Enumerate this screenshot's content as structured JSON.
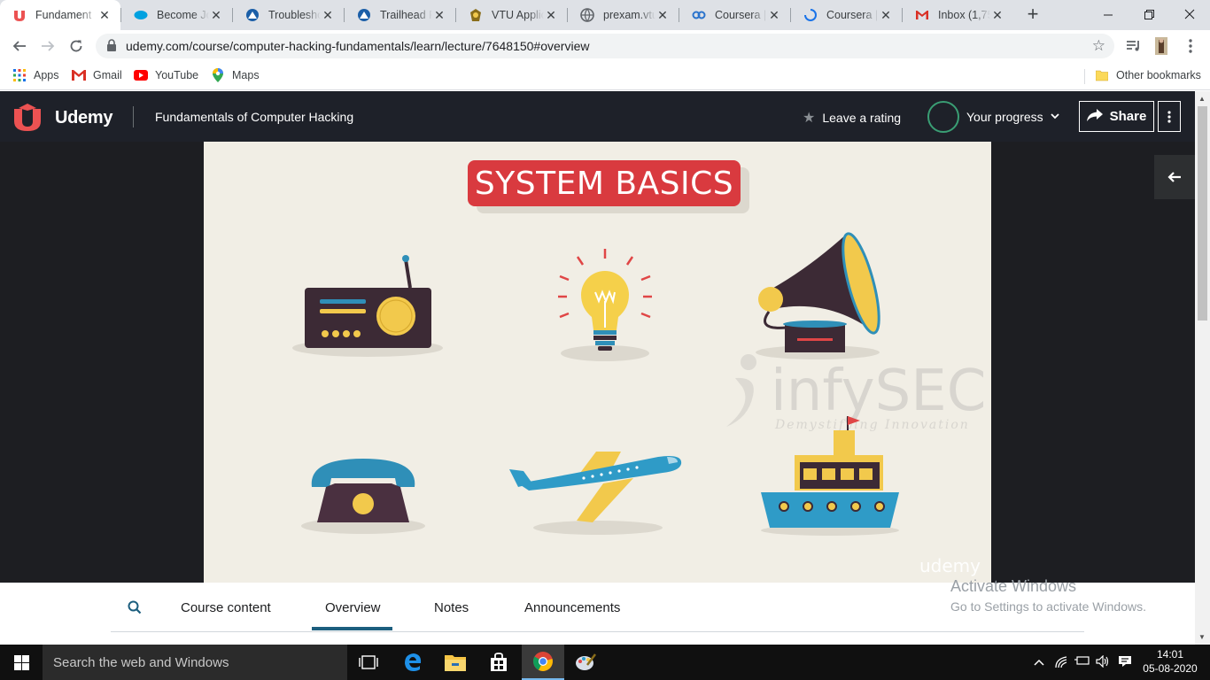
{
  "browser": {
    "tabs": [
      {
        "title": "Fundament",
        "icon": "udemy-favicon",
        "active": true
      },
      {
        "title": "Become Jol",
        "icon": "salesforce-favicon"
      },
      {
        "title": "Troublesho",
        "icon": "trailhead-favicon"
      },
      {
        "title": "Trailhead Pl",
        "icon": "trailhead-favicon"
      },
      {
        "title": "VTU Applic",
        "icon": "vtu-favicon"
      },
      {
        "title": "prexam.vtu",
        "icon": "globe-favicon"
      },
      {
        "title": "Coursera | C",
        "icon": "coursera-favicon"
      },
      {
        "title": "Coursera | C",
        "icon": "loading-spinner"
      },
      {
        "title": "Inbox (1,75",
        "icon": "gmail-favicon"
      }
    ],
    "url": "udemy.com/course/computer-hacking-fundamentals/learn/lecture/7648150#overview",
    "bookmarks": [
      {
        "label": "Apps",
        "icon": "apps-grid-icon"
      },
      {
        "label": "Gmail",
        "icon": "gmail-icon"
      },
      {
        "label": "YouTube",
        "icon": "youtube-icon"
      },
      {
        "label": "Maps",
        "icon": "maps-icon"
      }
    ],
    "other_bookmarks": "Other bookmarks"
  },
  "udemy": {
    "logo_text": "Udemy",
    "course_title": "Fundamentals of Computer Hacking",
    "rating_label": "Leave a rating",
    "progress_label": "Your progress",
    "share_label": "Share"
  },
  "slide": {
    "banner": "SYSTEM BASICS",
    "watermark": "infySEC",
    "watermark_sub": "Demystifying Innovation",
    "udemy_watermark": "udemy",
    "illustrations": [
      "radio",
      "light bulb",
      "gramophone",
      "telephone",
      "airplane",
      "ship"
    ]
  },
  "lecture_tabs": {
    "items": [
      "Course content",
      "Overview",
      "Notes",
      "Announcements"
    ],
    "active": "Overview"
  },
  "activate_windows": {
    "title": "Activate Windows",
    "subtitle": "Go to Settings to activate Windows."
  },
  "taskbar": {
    "search_placeholder": "Search the web and Windows",
    "time": "14:01",
    "date": "05-08-2020"
  },
  "colors": {
    "udemy_red": "#ec5252",
    "header_bg": "#1e2129",
    "progress_ring": "#3a9e74",
    "banner_red": "#d93a3f",
    "slide_bg": "#f1eee5"
  }
}
